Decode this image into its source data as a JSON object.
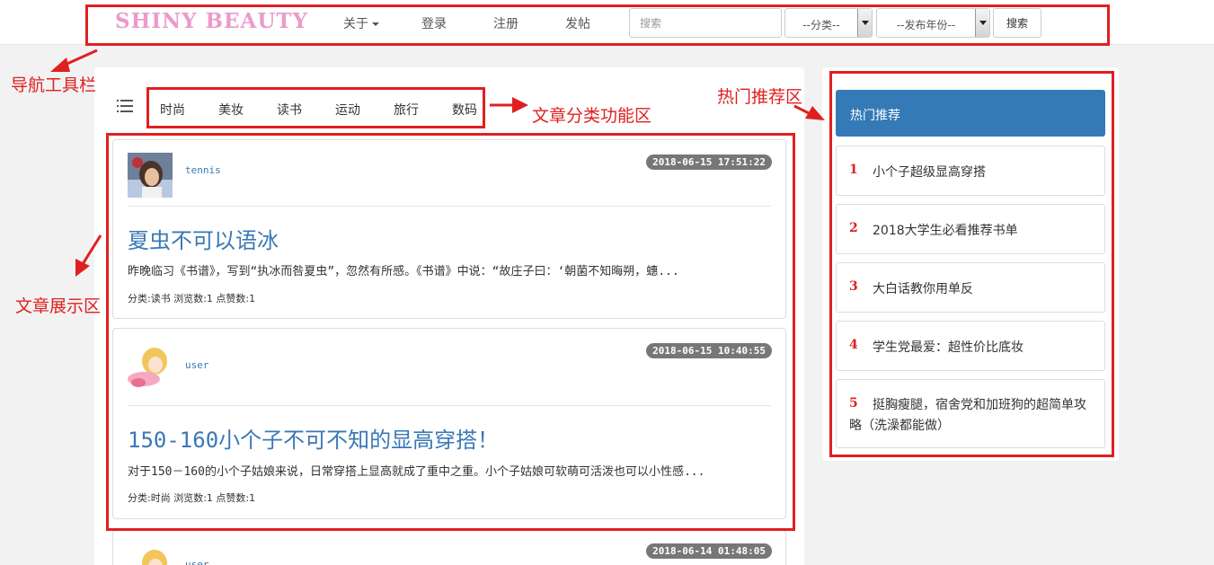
{
  "navbar": {
    "brand": "SHINY BEAUTY",
    "about": "关于",
    "login": "登录",
    "register": "注册",
    "post": "发帖",
    "search_placeholder": "搜索",
    "category_select": "--分类--",
    "year_select": "--发布年份--",
    "search_button": "搜索"
  },
  "categories": [
    "时尚",
    "美妆",
    "读书",
    "运动",
    "旅行",
    "数码"
  ],
  "articles": [
    {
      "user": "tennis",
      "date": "2018-06-15 17:51:22",
      "title": "夏虫不可以语冰",
      "excerpt": "昨晚临习《书谱》，写到“执冰而咎夏虫”，忽然有所感。《书谱》中说：“故庄子曰：‘朝菌不知晦朔，蟪...",
      "meta": "分类:读书 浏览数:1 点赞数:1"
    },
    {
      "user": "user",
      "date": "2018-06-15 10:40:55",
      "title": "150-160小个子不可不知的显高穿搭！",
      "excerpt": "对于150－160的小个子姑娘来说，日常穿搭上显高就成了重中之重。小个子姑娘可软萌可活泼也可以小性感...",
      "meta": "分类:时尚 浏览数:1 点赞数:1"
    },
    {
      "user": "user",
      "date": "2018-06-14 01:48:05"
    }
  ],
  "hot": {
    "title": "热门推荐",
    "items": [
      {
        "num": "1",
        "text": "小个子超级显高穿搭"
      },
      {
        "num": "2",
        "text": "2018大学生必看推荐书单"
      },
      {
        "num": "3",
        "text": "大白话教你用单反"
      },
      {
        "num": "4",
        "text": "学生党最爱：超性价比底妆"
      },
      {
        "num": "5",
        "text": "挺胸瘦腿，宿舍党和加班狗的超简单攻略（洗澡都能做）"
      }
    ]
  },
  "annotations": {
    "nav": "导航工具栏",
    "categories": "文章分类功能区",
    "articles": "文章展示区",
    "hot": "热门推荐区"
  },
  "colors": {
    "brand": "#ec9acb",
    "link": "#337ab7",
    "annotation": "#e02020",
    "badge": "#777777"
  }
}
